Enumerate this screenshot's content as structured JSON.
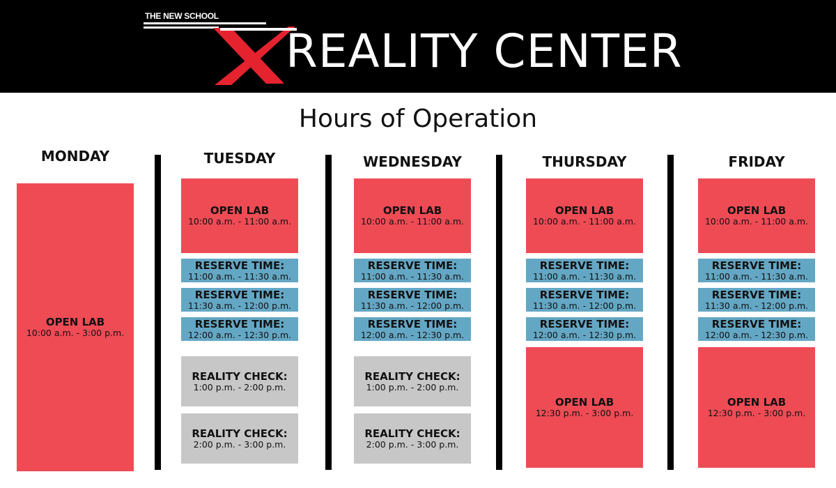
{
  "header": {
    "school": "THE NEW SCHOOL",
    "brand": "REALITY CENTER",
    "colors": {
      "background": "#000000",
      "x_mark": "#e5232f",
      "text": "#ffffff"
    }
  },
  "title": "Hours of Operation",
  "days": [
    {
      "name": "MONDAY",
      "blocks": [
        {
          "title": "OPEN LAB",
          "time": "10:00 a.m. - 3:00 p.m."
        }
      ]
    },
    {
      "name": "TUESDAY",
      "blocks": [
        {
          "title": "OPEN LAB",
          "time": "10:00 a.m. - 11:00 a.m."
        },
        {
          "title": "RESERVE TIME:",
          "time": "11:00 a.m. - 11:30 a.m."
        },
        {
          "title": "RESERVE TIME:",
          "time": "11:30 a.m. - 12:00 p.m."
        },
        {
          "title": "RESERVE TIME:",
          "time": "12:00 a.m. - 12:30 p.m."
        },
        {
          "title": "REALITY CHECK:",
          "time": "1:00 p.m. - 2:00 p.m."
        },
        {
          "title": "REALITY CHECK:",
          "time": "2:00 p.m. - 3:00 p.m."
        }
      ]
    },
    {
      "name": "WEDNESDAY",
      "blocks": [
        {
          "title": "OPEN LAB",
          "time": "10:00 a.m. - 11:00 a.m."
        },
        {
          "title": "RESERVE TIME:",
          "time": "11:00 a.m. - 11:30 a.m."
        },
        {
          "title": "RESERVE TIME:",
          "time": "11:30 a.m. - 12:00 p.m."
        },
        {
          "title": "RESERVE TIME:",
          "time": "12:00 a.m. - 12:30 p.m."
        },
        {
          "title": "REALITY CHECK:",
          "time": "1:00 p.m. - 2:00 p.m."
        },
        {
          "title": "REALITY CHECK:",
          "time": "2:00 p.m. - 3:00 p.m."
        }
      ]
    },
    {
      "name": "THURSDAY",
      "blocks": [
        {
          "title": "OPEN LAB",
          "time": "10:00 a.m. - 11:00 a.m."
        },
        {
          "title": "RESERVE TIME:",
          "time": "11:00 a.m. - 11:30 a.m."
        },
        {
          "title": "RESERVE TIME:",
          "time": "11:30 a.m. - 12:00 p.m."
        },
        {
          "title": "RESERVE TIME:",
          "time": "12:00 a.m. - 12:30 p.m."
        },
        {
          "title": "OPEN LAB",
          "time": "12:30 p.m. - 3:00 p.m."
        }
      ]
    },
    {
      "name": "FRIDAY",
      "blocks": [
        {
          "title": "OPEN LAB",
          "time": "10:00 a.m. - 11:00 a.m."
        },
        {
          "title": "RESERVE TIME:",
          "time": "11:00 a.m. - 11:30 a.m."
        },
        {
          "title": "RESERVE TIME:",
          "time": "11:30 a.m. - 12:00 p.m."
        },
        {
          "title": "RESERVE TIME:",
          "time": "12:00 a.m. - 12:30 p.m."
        },
        {
          "title": "OPEN LAB",
          "time": "12:30 p.m. - 3:00 p.m."
        }
      ]
    }
  ],
  "colors": {
    "open_lab": "#ef4b55",
    "reserve_time": "#64a7c4",
    "reality_check": "#c7c7c7",
    "divider": "#000000"
  }
}
